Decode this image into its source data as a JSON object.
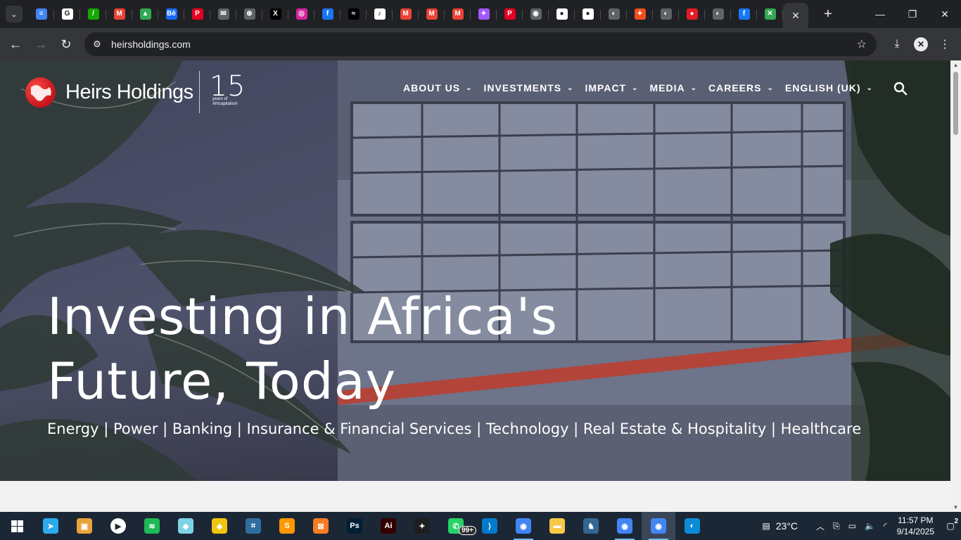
{
  "browser": {
    "tabs": [
      {
        "icon": "google-forms-icon",
        "color": "#4285f4",
        "glyph": "≡"
      },
      {
        "icon": "google-icon",
        "color": "#ffffff",
        "glyph": "G"
      },
      {
        "icon": "upwork-icon",
        "color": "#14a800",
        "glyph": "/"
      },
      {
        "icon": "gmail-icon",
        "color": "#ea4335",
        "glyph": "M"
      },
      {
        "icon": "google-drive-icon",
        "color": "#34a853",
        "glyph": "▲"
      },
      {
        "icon": "behance-icon",
        "color": "#1769ff",
        "glyph": "Bē"
      },
      {
        "icon": "pinterest-icon",
        "color": "#e60023",
        "glyph": "P"
      },
      {
        "icon": "mail-icon",
        "color": "#5f6368",
        "glyph": "✉"
      },
      {
        "icon": "chatgpt-icon",
        "color": "#5f6368",
        "glyph": "⊛"
      },
      {
        "icon": "x-icon",
        "color": "#000000",
        "glyph": "X"
      },
      {
        "icon": "instagram-icon",
        "color": "#d6249f",
        "glyph": "◎"
      },
      {
        "icon": "facebook-icon",
        "color": "#1877f2",
        "glyph": "f"
      },
      {
        "icon": "capcut-icon",
        "color": "#000000",
        "glyph": "≈"
      },
      {
        "icon": "tiktok-icon",
        "color": "#ffffff",
        "glyph": "♪"
      },
      {
        "icon": "gmail-icon",
        "color": "#ea4335",
        "glyph": "M"
      },
      {
        "icon": "gmail-icon",
        "color": "#ea4335",
        "glyph": "M"
      },
      {
        "icon": "gmail-icon",
        "color": "#ea4335",
        "glyph": "M"
      },
      {
        "icon": "figma-icon",
        "color": "#a259ff",
        "glyph": "✦"
      },
      {
        "icon": "pinterest-icon",
        "color": "#e60023",
        "glyph": "P"
      },
      {
        "icon": "chrome-icon",
        "color": "#5f6368",
        "glyph": "◉"
      },
      {
        "icon": "github-icon",
        "color": "#ffffff",
        "glyph": "●"
      },
      {
        "icon": "github-icon",
        "color": "#ffffff",
        "glyph": "●"
      },
      {
        "icon": "globe-icon",
        "color": "#5f6368",
        "glyph": "◐"
      },
      {
        "icon": "figma-icon",
        "color": "#f24e1e",
        "glyph": "✦"
      },
      {
        "icon": "globe-icon",
        "color": "#5f6368",
        "glyph": "◐"
      },
      {
        "icon": "heirs-icon",
        "color": "#e31b23",
        "glyph": "●"
      },
      {
        "icon": "globe-icon",
        "color": "#5f6368",
        "glyph": "◐"
      },
      {
        "icon": "facebook-icon",
        "color": "#1877f2",
        "glyph": "f"
      },
      {
        "icon": "multicolor-icon",
        "color": "#34a853",
        "glyph": "✕"
      }
    ],
    "url": "heirsholdings.com"
  },
  "site": {
    "logo_text": "Heirs Holdings",
    "anniversary_number": "15",
    "anniversary_caption": "years of Africapitalism",
    "nav": [
      {
        "label": "ABOUT US"
      },
      {
        "label": "INVESTMENTS"
      },
      {
        "label": "IMPACT"
      },
      {
        "label": "MEDIA"
      },
      {
        "label": "CAREERS"
      },
      {
        "label": "ENGLISH (UK)"
      }
    ],
    "headline_line1": "Investing in Africa's",
    "headline_line2": "Future, Today",
    "sectors": "Energy | Power | Banking | Insurance & Financial Services | Technology | Real Estate & Hospitality | Healthcare"
  },
  "taskbar": {
    "apps": [
      {
        "icon": "telegram-icon",
        "color": "#2aabee",
        "glyph": "➤"
      },
      {
        "icon": "video-editor-icon",
        "color": "#e8a33d",
        "glyph": "▣"
      },
      {
        "icon": "media-player-icon",
        "color": "#ffffff",
        "glyph": "▶"
      },
      {
        "icon": "spotify-icon",
        "color": "#1db954",
        "glyph": "≋"
      },
      {
        "icon": "notes-icon",
        "color": "#7fd3e6",
        "glyph": "◆"
      },
      {
        "icon": "git-icon",
        "color": "#f1c40f",
        "glyph": "◈"
      },
      {
        "icon": "mysql-workbench-icon",
        "color": "#2f6f9f",
        "glyph": "⌗"
      },
      {
        "icon": "sublime-icon",
        "color": "#ff9800",
        "glyph": "S"
      },
      {
        "icon": "xampp-icon",
        "color": "#fb7a24",
        "glyph": "⊠"
      },
      {
        "icon": "photoshop-icon",
        "color": "#001e36",
        "glyph": "Ps"
      },
      {
        "icon": "illustrator-icon",
        "color": "#330000",
        "glyph": "Ai"
      },
      {
        "icon": "figma-icon",
        "color": "#1e1e1e",
        "glyph": "✦"
      },
      {
        "icon": "whatsapp-icon",
        "color": "#25d366",
        "glyph": "✆"
      },
      {
        "icon": "vscode-icon",
        "color": "#007acc",
        "glyph": "⟩"
      },
      {
        "icon": "chrome-icon",
        "color": "#4285f4",
        "glyph": "◉"
      },
      {
        "icon": "file-explorer-icon",
        "color": "#f7c948",
        "glyph": "▬"
      },
      {
        "icon": "postgres-icon",
        "color": "#336791",
        "glyph": "♞"
      },
      {
        "icon": "chrome-profile-icon",
        "color": "#4285f4",
        "glyph": "◉"
      },
      {
        "icon": "chrome-profile-icon",
        "color": "#4285f4",
        "glyph": "◉"
      },
      {
        "icon": "edge-icon",
        "color": "#0c8cd8",
        "glyph": "◐"
      }
    ],
    "whatsapp_badge": "99+",
    "weather": "23°C",
    "time": "11:57 PM",
    "date": "9/14/2025",
    "notifications": "2"
  }
}
